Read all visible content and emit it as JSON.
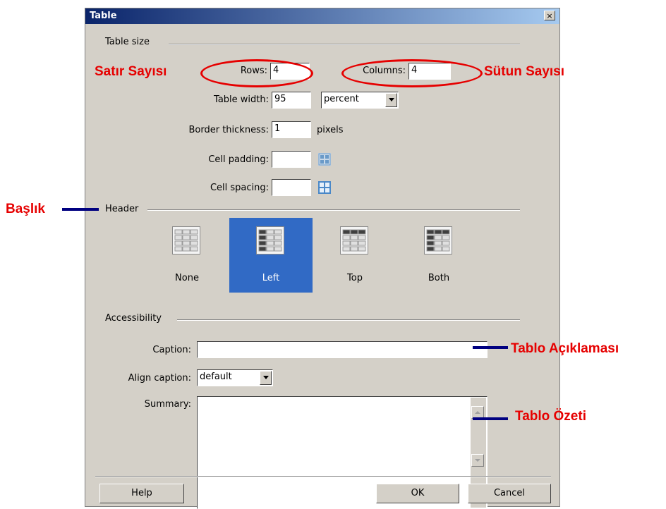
{
  "dialog": {
    "title": "Table",
    "close_label": "×"
  },
  "table_size": {
    "section_label": "Table size",
    "rows_label": "Rows:",
    "rows_value": "4",
    "columns_label": "Columns:",
    "columns_value": "4",
    "width_label": "Table width:",
    "width_value": "95",
    "width_unit": "percent",
    "border_label": "Border thickness:",
    "border_value": "1",
    "border_unit": "pixels",
    "padding_label": "Cell padding:",
    "padding_value": "",
    "spacing_label": "Cell spacing:",
    "spacing_value": ""
  },
  "header": {
    "section_label": "Header",
    "options": [
      {
        "label": "None",
        "icon": "table-none-icon",
        "selected": false
      },
      {
        "label": "Left",
        "icon": "table-left-header-icon",
        "selected": true
      },
      {
        "label": "Top",
        "icon": "table-top-header-icon",
        "selected": false
      },
      {
        "label": "Both",
        "icon": "table-both-header-icon",
        "selected": false
      }
    ]
  },
  "accessibility": {
    "section_label": "Accessibility",
    "caption_label": "Caption:",
    "caption_value": "",
    "align_caption_label": "Align caption:",
    "align_caption_value": "default",
    "summary_label": "Summary:",
    "summary_value": ""
  },
  "buttons": {
    "help": "Help",
    "ok": "OK",
    "cancel": "Cancel"
  },
  "annotations": {
    "rows": "Satır Sayısı",
    "columns": "Sütun Sayısı",
    "header": "Başlık",
    "caption": "Tablo Açıklaması",
    "summary": "Tablo Özeti"
  },
  "colors": {
    "annotation_red": "#e60000",
    "pointer_navy": "#000080",
    "selected_blue": "#316ac5",
    "dialog_gray": "#d4d0c8"
  }
}
